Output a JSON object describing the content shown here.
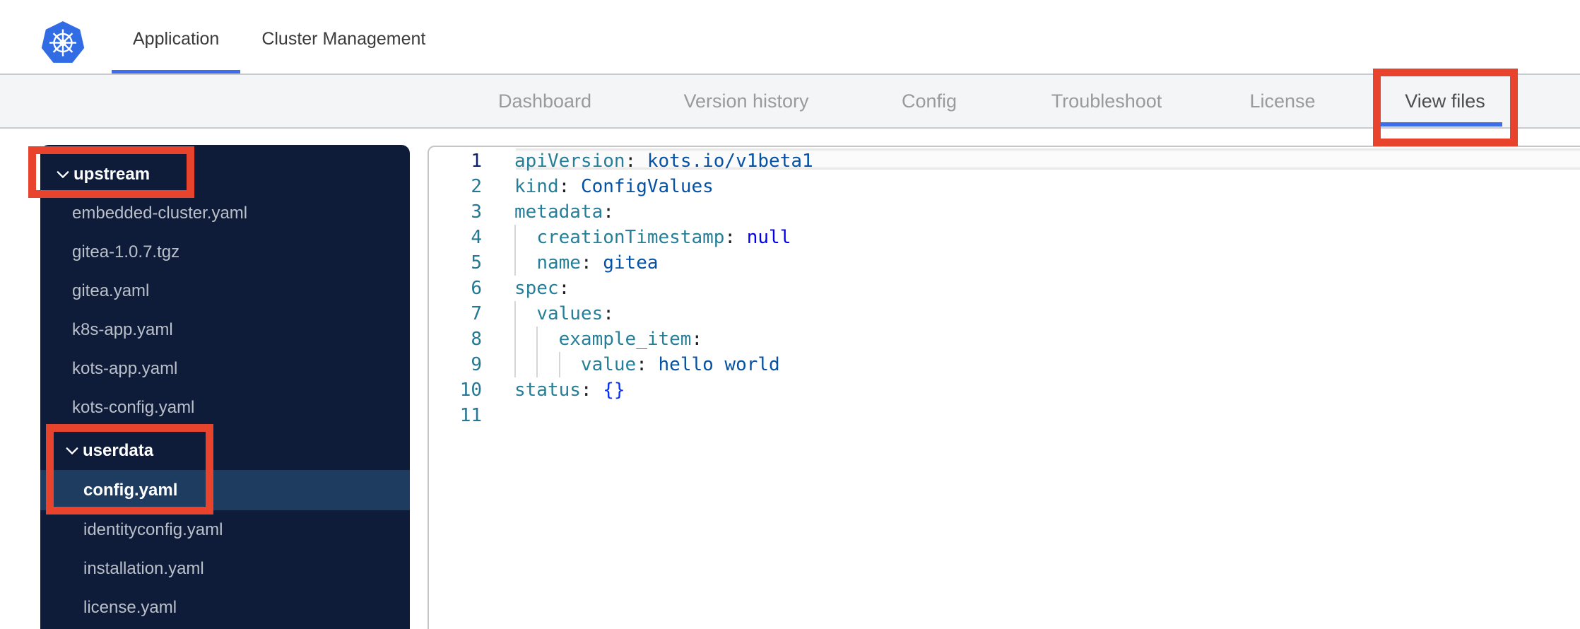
{
  "topbar": {
    "logo": "kubernetes-logo",
    "tabs": [
      {
        "label": "Application",
        "active": true
      },
      {
        "label": "Cluster Management",
        "active": false
      }
    ]
  },
  "subnav": {
    "tabs": [
      "Dashboard",
      "Version history",
      "Config",
      "Troubleshoot",
      "License",
      "View files"
    ],
    "active": "View files"
  },
  "file_tree": {
    "items": [
      {
        "label": "upstream",
        "type": "folder",
        "depth": 0,
        "expanded": true
      },
      {
        "label": "embedded-cluster.yaml",
        "type": "file",
        "depth": 1
      },
      {
        "label": "gitea-1.0.7.tgz",
        "type": "file",
        "depth": 1
      },
      {
        "label": "gitea.yaml",
        "type": "file",
        "depth": 1
      },
      {
        "label": "k8s-app.yaml",
        "type": "file",
        "depth": 1
      },
      {
        "label": "kots-app.yaml",
        "type": "file",
        "depth": 1
      },
      {
        "label": "kots-config.yaml",
        "type": "file",
        "depth": 1
      },
      {
        "label": "userdata",
        "type": "folder",
        "depth": 1,
        "expanded": true,
        "gap_before": true
      },
      {
        "label": "config.yaml",
        "type": "file",
        "depth": 2,
        "selected": true
      },
      {
        "label": "identityconfig.yaml",
        "type": "file",
        "depth": 2
      },
      {
        "label": "installation.yaml",
        "type": "file",
        "depth": 2
      },
      {
        "label": "license.yaml",
        "type": "file",
        "depth": 2
      }
    ]
  },
  "editor": {
    "language": "yaml",
    "current_line": 1,
    "lines": [
      {
        "num": 1,
        "guides": [],
        "tokens": [
          [
            "key",
            "apiVersion"
          ],
          [
            "pun",
            ":"
          ],
          [
            "plain",
            " "
          ],
          [
            "str",
            "kots.io/v1beta1"
          ]
        ]
      },
      {
        "num": 2,
        "guides": [],
        "tokens": [
          [
            "key",
            "kind"
          ],
          [
            "pun",
            ":"
          ],
          [
            "plain",
            " "
          ],
          [
            "str",
            "ConfigValues"
          ]
        ]
      },
      {
        "num": 3,
        "guides": [],
        "tokens": [
          [
            "key",
            "metadata"
          ],
          [
            "pun",
            ":"
          ]
        ]
      },
      {
        "num": 4,
        "guides": [
          0
        ],
        "tokens": [
          [
            "plain",
            "  "
          ],
          [
            "key",
            "creationTimestamp"
          ],
          [
            "pun",
            ":"
          ],
          [
            "plain",
            " "
          ],
          [
            "kw",
            "null"
          ]
        ]
      },
      {
        "num": 5,
        "guides": [
          0
        ],
        "tokens": [
          [
            "plain",
            "  "
          ],
          [
            "key",
            "name"
          ],
          [
            "pun",
            ":"
          ],
          [
            "plain",
            " "
          ],
          [
            "str",
            "gitea"
          ]
        ]
      },
      {
        "num": 6,
        "guides": [],
        "tokens": [
          [
            "key",
            "spec"
          ],
          [
            "pun",
            ":"
          ]
        ]
      },
      {
        "num": 7,
        "guides": [
          0
        ],
        "tokens": [
          [
            "plain",
            "  "
          ],
          [
            "key",
            "values"
          ],
          [
            "pun",
            ":"
          ]
        ]
      },
      {
        "num": 8,
        "guides": [
          0,
          2
        ],
        "tokens": [
          [
            "plain",
            "    "
          ],
          [
            "key",
            "example_item"
          ],
          [
            "pun",
            ":"
          ]
        ]
      },
      {
        "num": 9,
        "guides": [
          0,
          2,
          4
        ],
        "tokens": [
          [
            "plain",
            "      "
          ],
          [
            "key",
            "value"
          ],
          [
            "pun",
            ":"
          ],
          [
            "plain",
            " "
          ],
          [
            "str",
            "hello world"
          ]
        ]
      },
      {
        "num": 10,
        "guides": [],
        "tokens": [
          [
            "key",
            "status"
          ],
          [
            "pun",
            ":"
          ],
          [
            "plain",
            " "
          ],
          [
            "brace",
            "{}"
          ]
        ]
      },
      {
        "num": 11,
        "guides": [],
        "tokens": []
      }
    ]
  },
  "annotations": {
    "color": "#e8432c",
    "boxes": [
      "upstream-folder",
      "userdata-config-yaml",
      "view-files-tab"
    ]
  },
  "colors": {
    "accent_blue": "#3d6dea",
    "kubernetes_blue": "#326ce5",
    "sidebar_bg": "#0e1c3a",
    "sidebar_selected_bg": "#1e3c5f",
    "subnav_bg": "#f4f5f7",
    "yaml_key": "#267f99",
    "yaml_string": "#0451a5",
    "yaml_keyword": "#0000ee",
    "annotation_red": "#e8432c"
  }
}
